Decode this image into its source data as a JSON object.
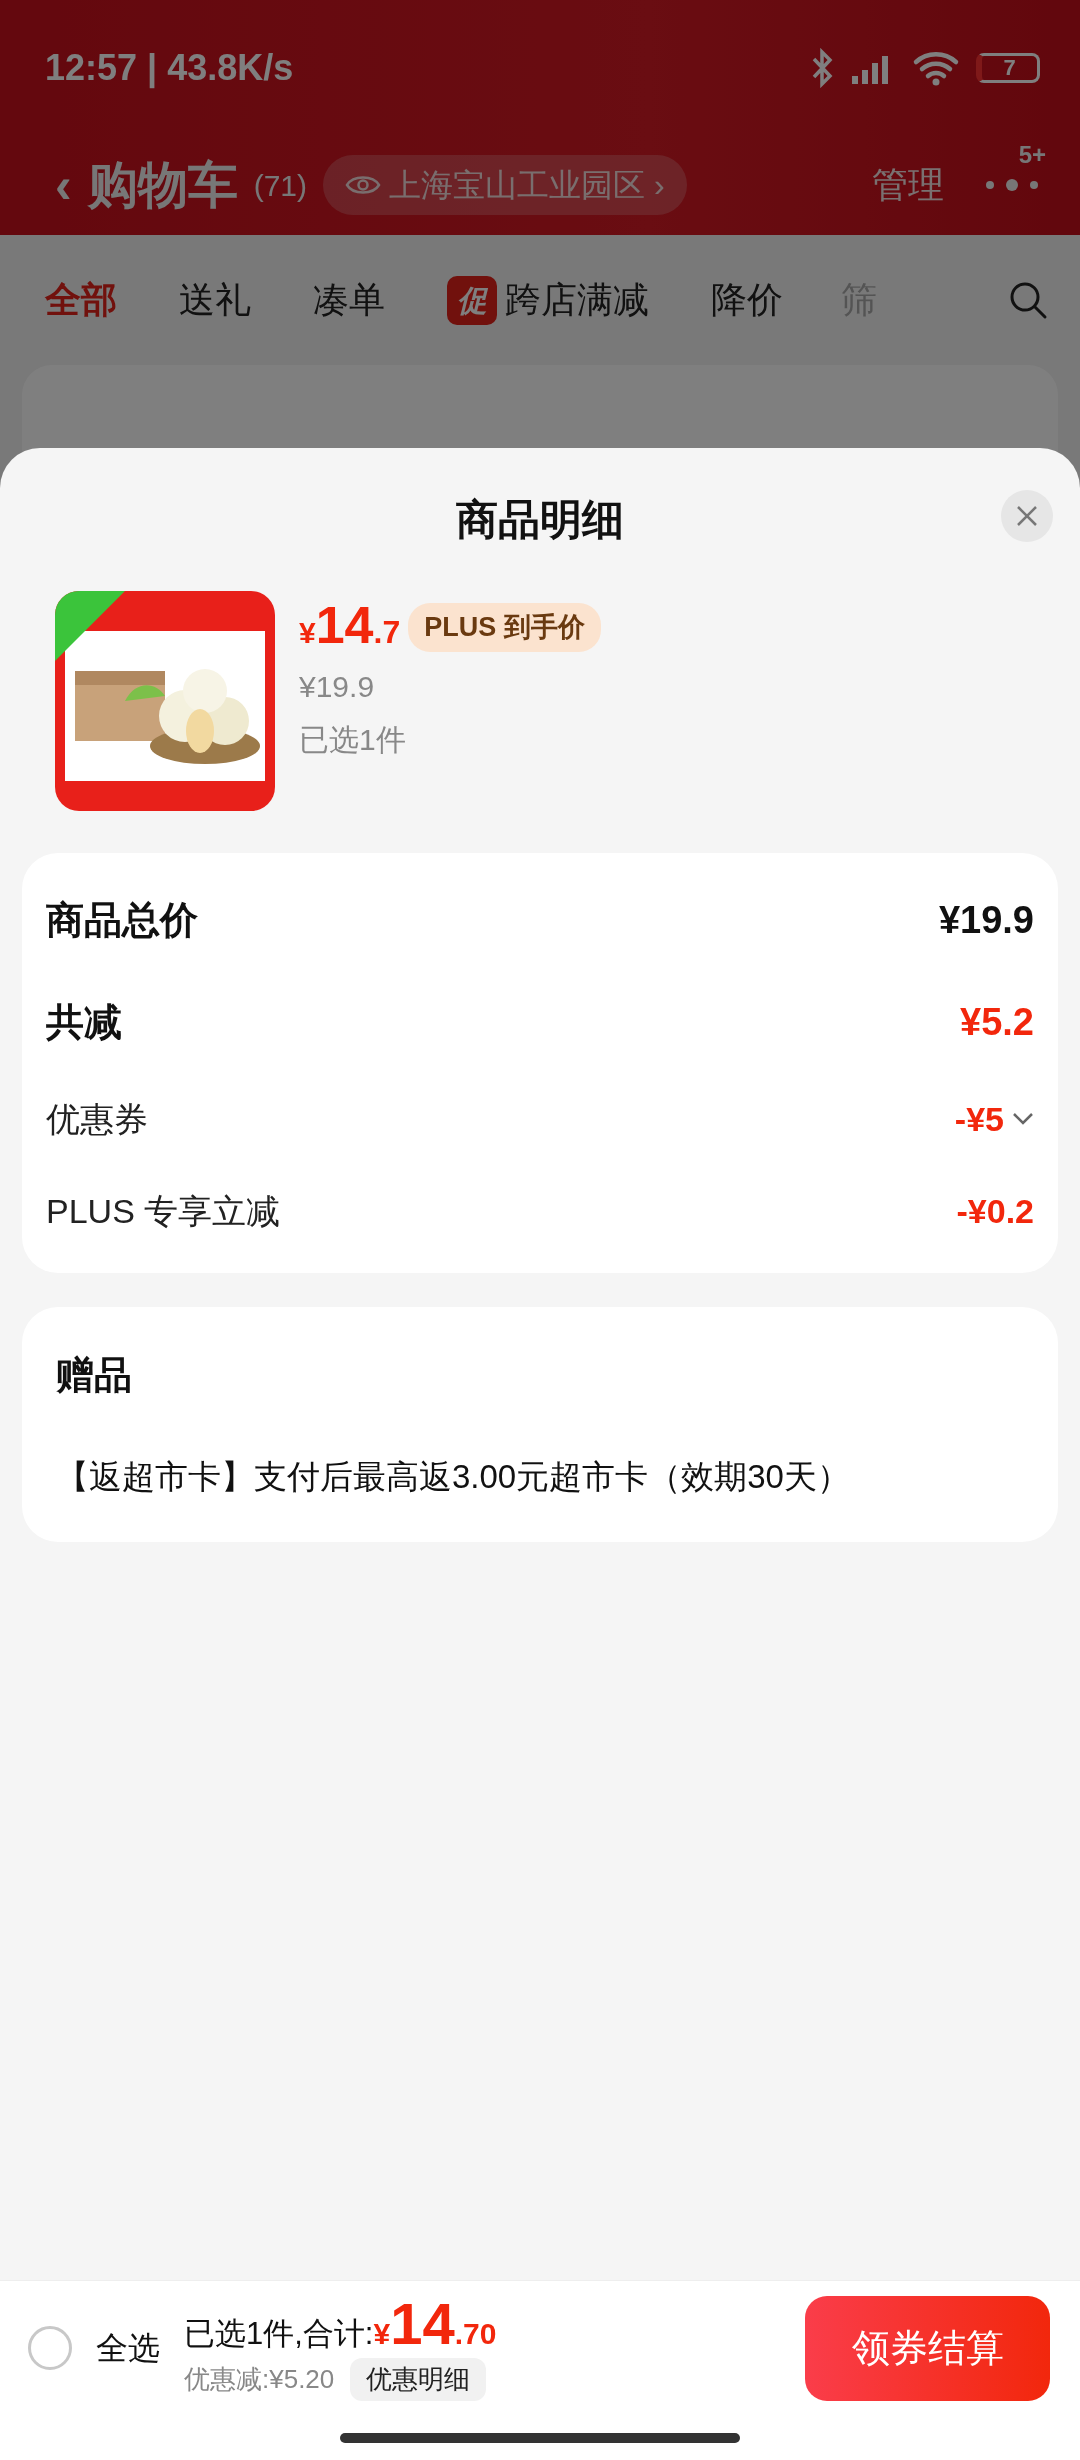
{
  "status_bar": {
    "time": "12:57 | 43.8K/s",
    "battery": "7"
  },
  "header": {
    "back": "‹",
    "title": "购物车",
    "count": "(71)",
    "location": "上海宝山工业园区",
    "location_chevron": "›",
    "manage": "管理",
    "badge": "5+"
  },
  "tabs": [
    {
      "label": "全部",
      "selected": true
    },
    {
      "label": "送礼",
      "selected": false
    },
    {
      "label": "凑单",
      "selected": false
    },
    {
      "label": "跨店满减",
      "tag": "促",
      "selected": false
    },
    {
      "label": "降价",
      "selected": false
    },
    {
      "label": "筛",
      "selected": false
    }
  ],
  "sheet": {
    "title": "商品明细",
    "product": {
      "currency": "¥",
      "price_int": "14",
      "price_dec": ".7",
      "plus_tag": "PLUS 到手价",
      "original_price": "¥19.9",
      "selected_count": "已选1件"
    },
    "breakdown": [
      {
        "label": "商品总价",
        "value": "¥19.9",
        "kind": "total"
      },
      {
        "label": "共减",
        "value": "¥5.2",
        "kind": "reduction"
      },
      {
        "label": "优惠券",
        "value": "-¥5",
        "kind": "discount",
        "expandable": true
      },
      {
        "label": "PLUS 专享立减",
        "value": "-¥0.2",
        "kind": "discount",
        "expandable": false
      }
    ],
    "gift": {
      "title": "赠品",
      "text": "【返超市卡】支付后最高返3.00元超市卡（效期30天）"
    }
  },
  "bottom_bar": {
    "select_all": {
      "label": "全选",
      "checked": false
    },
    "summary": "已选1件,合计:",
    "currency": "¥",
    "total_int": "14",
    "total_dec": ".70",
    "discount": "优惠减:¥5.20",
    "detail_button": "优惠明细",
    "checkout": "领券结算"
  }
}
